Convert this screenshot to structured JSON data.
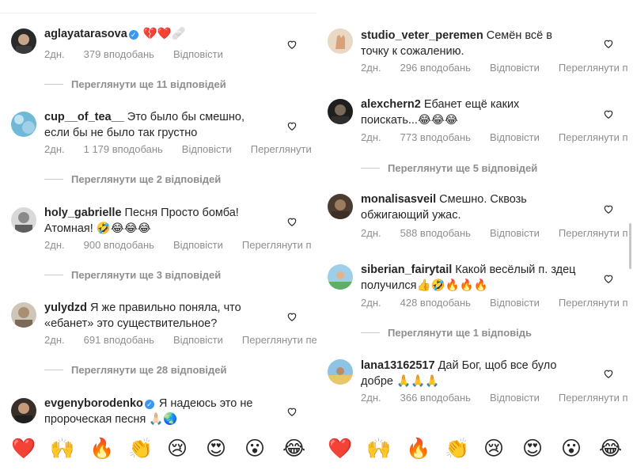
{
  "left": {
    "comments": [
      {
        "username": "aglayatarasova",
        "verified": true,
        "text": "💔❤️🩹",
        "time": "2дн.",
        "likes": "379 вподобань",
        "reply": "Відповісти",
        "translate": "",
        "replies_label": "Переглянути ще 11 відповідей"
      },
      {
        "username": "cup__of_tea__",
        "verified": false,
        "text": "Это было бы смешно, если бы не было так грустно",
        "time": "2дн.",
        "likes": "1 179 вподобань",
        "reply": "Відповісти",
        "translate": "Переглянути",
        "replies_label": "Переглянути ще 2 відповідей"
      },
      {
        "username": "holy_gabrielle",
        "verified": false,
        "text": "Песня Просто бомба! Атомная! 🤣😂😂😂",
        "time": "2дн.",
        "likes": "900 вподобань",
        "reply": "Відповісти",
        "translate": "Переглянути п",
        "replies_label": "Переглянути ще 3 відповідей"
      },
      {
        "username": "yulydzd",
        "verified": false,
        "text": "Я же правильно поняла, что «ебанет» это существительное?",
        "time": "2дн.",
        "likes": "691 вподобань",
        "reply": "Відповісти",
        "translate": "Переглянути пе",
        "replies_label": "Переглянути ще 28 відповідей"
      },
      {
        "username": "evgenyborodenko",
        "verified": true,
        "text": "Я надеюсь это не пророческая песня 🙏🏻🌏",
        "time": "",
        "likes": "",
        "reply": "",
        "translate": "",
        "replies_label": ""
      }
    ],
    "emojis": [
      "❤️",
      "🙌",
      "🔥",
      "👏",
      "😢",
      "😍",
      "😮",
      "😂"
    ]
  },
  "right": {
    "comments": [
      {
        "username": "studio_veter_peremen",
        "verified": false,
        "text": "Семён всё в точку к сожалению.",
        "time": "2дн.",
        "likes": "296 вподобань",
        "reply": "Відповісти",
        "translate": "Переглянути п",
        "replies_label": ""
      },
      {
        "username": "alexchern2",
        "verified": false,
        "text": "Ебанет ещё каких поискать...😂😂😂",
        "time": "2дн.",
        "likes": "773 вподобань",
        "reply": "Відповісти",
        "translate": "Переглянути п",
        "replies_label": "Переглянути ще 5 відповідей"
      },
      {
        "username": "monalisasveil",
        "verified": false,
        "text": "Смешно. Сквозь обжигающий ужас.",
        "time": "2дн.",
        "likes": "588 вподобань",
        "reply": "Відповісти",
        "translate": "Переглянути п",
        "replies_label": ""
      },
      {
        "username": "siberian_fairytail",
        "verified": false,
        "text": "Какой весёлый п. здец получился👍🤣🔥🔥🔥",
        "time": "2дн.",
        "likes": "428 вподобань",
        "reply": "Відповісти",
        "translate": "Переглянути п",
        "replies_label": "Переглянути ще 1 відповідь"
      },
      {
        "username": "lana13162517",
        "verified": false,
        "text": "Дай Бог, щоб все було добре 🙏🙏🙏",
        "time": "2дн.",
        "likes": "366 вподобань",
        "reply": "Відповісти",
        "translate": "Переглянути п",
        "replies_label": ""
      }
    ],
    "emojis": [
      "❤️",
      "🙌",
      "🔥",
      "👏",
      "😢",
      "😍",
      "😮",
      "😂"
    ]
  },
  "colors": {
    "text": "#262626",
    "meta": "#8e8e8e",
    "verified": "#3897f0",
    "divider": "#c7c7c7"
  }
}
